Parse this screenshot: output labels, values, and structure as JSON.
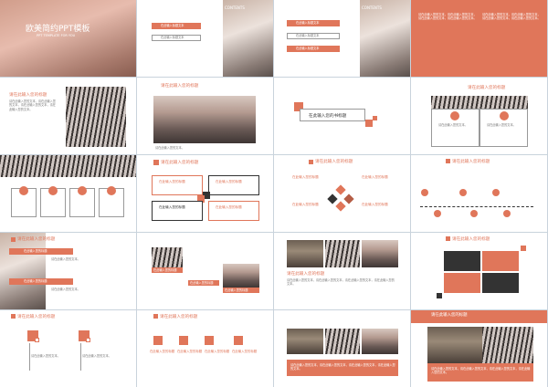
{
  "cover": {
    "title": "欧美简约PPT模板",
    "subtitle": "PPT TEMPLATE FOR YOU"
  },
  "title_placeholder": "请在此输入您的标题",
  "book_title": "在此输入您的书标题",
  "text_short": "请在此输入您的文本。",
  "text_block": "请在此输入您的文本，请在此输入您的文本，请在此输入您的文本，请在此输入您的文本。",
  "label_placeholder": "在此输入您的标题",
  "contents_label": "CONTENTS",
  "button_label_1": "在此输入标题文本",
  "button_label_2": "在此输入标题文本",
  "colors": {
    "accent": "#e0765a",
    "dark": "#333333",
    "bg": "#c9d3dc"
  }
}
